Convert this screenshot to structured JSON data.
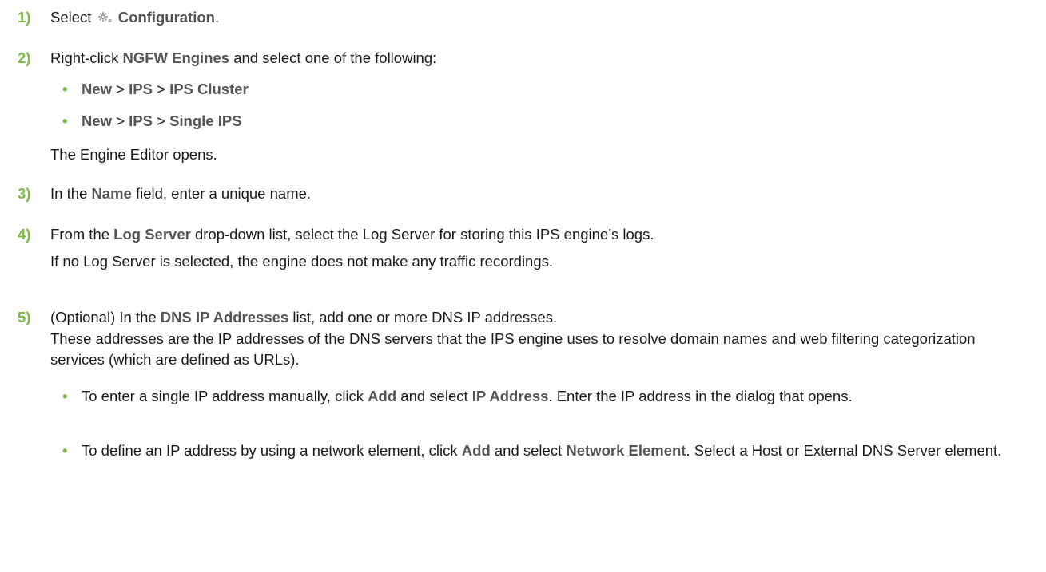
{
  "steps": [
    {
      "number": "1)",
      "parts": [
        "Select",
        "Configuration",
        "."
      ]
    },
    {
      "number": "2)",
      "parts": [
        "Right-click",
        "NGFW Engines",
        "and select one of the following:"
      ],
      "bullets": [
        {
          "a": "New",
          "sep1": ">",
          "b": "IPS",
          "sep2": ">",
          "c": "IPS Cluster"
        },
        {
          "a": "New",
          "sep1": ">",
          "b": "IPS",
          "sep2": ">",
          "c": "Single IPS"
        }
      ],
      "result": "The Engine Editor opens."
    },
    {
      "number": "3)",
      "parts": [
        "In the",
        "Name",
        "field, enter a unique name."
      ]
    },
    {
      "number": "4)",
      "parts": [
        "From the",
        "Log Server",
        "drop-down list, select the Log Server for storing this IPS engine’s logs."
      ],
      "note": "If no Log Server is selected, the engine does not make any traffic recordings."
    },
    {
      "number": "5)",
      "parts": [
        "(Optional) In the",
        "DNS IP Addresses",
        "list, add one or more DNS IP addresses."
      ],
      "note": "These addresses are the IP addresses of the DNS servers that the IPS engine uses to resolve domain names and web filtering categorization services (which are defined as URLs).",
      "bullets": [
        {
          "t1": "To enter a single IP address manually, click",
          "b1": "Add",
          "t2": "and select",
          "b2": "IP Address",
          "t3": ". Enter the IP address in the dialog that opens."
        },
        {
          "t1": "To define an IP address by using a network element, click",
          "b1": "Add",
          "t2": "and select",
          "b2": "Network Element",
          "t3": ". Select a Host or External DNS Server element."
        }
      ]
    }
  ],
  "icons": {
    "configuration": "gear-icon"
  },
  "colors": {
    "accent": "#7dbb42",
    "ui_label": "#555555",
    "text": "#1a1a1a"
  }
}
